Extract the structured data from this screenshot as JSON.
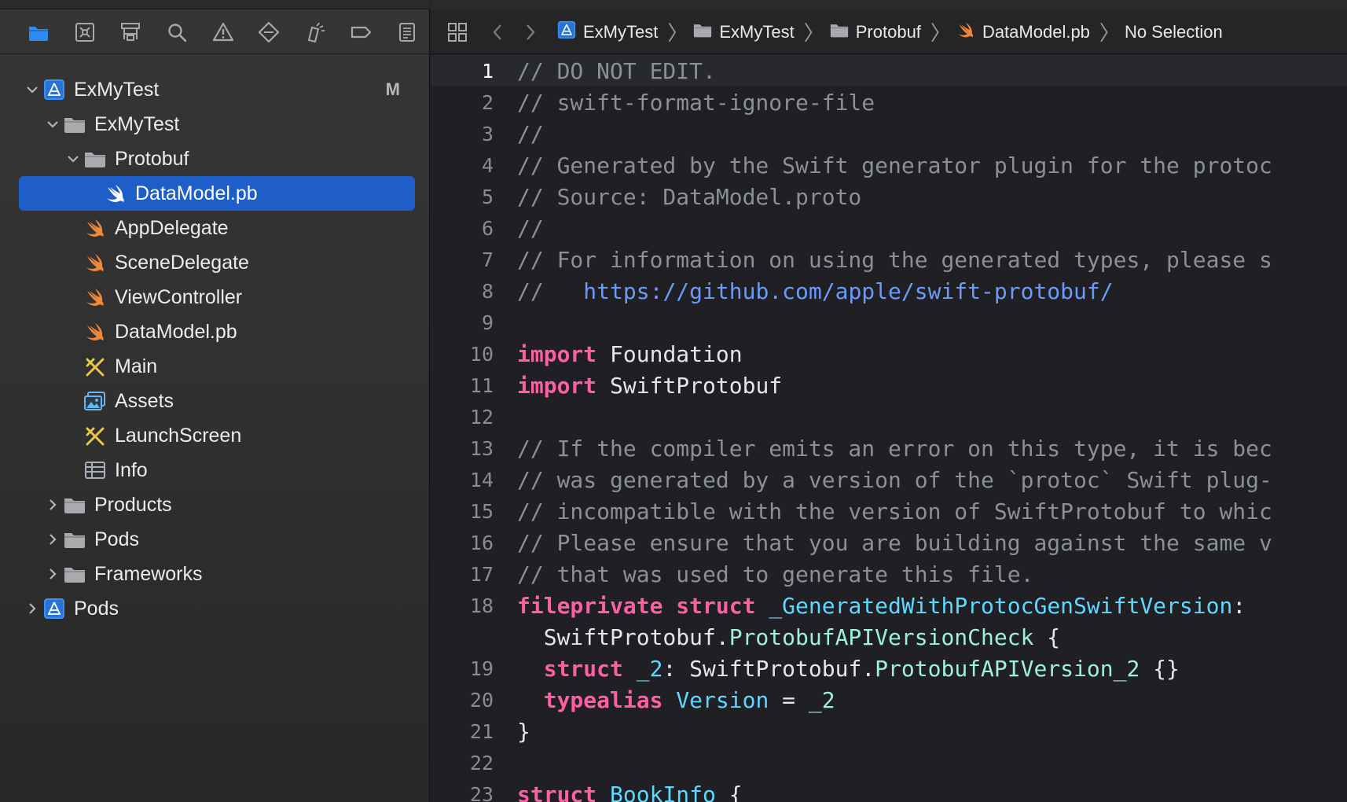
{
  "navigator": {
    "toolbar_icons": [
      "folder-icon",
      "source-control-icon",
      "symbol-icon",
      "search-icon",
      "warning-icon",
      "test-icon",
      "debug-icon",
      "breakpoint-icon",
      "report-icon"
    ],
    "tree": [
      {
        "label": "ExMyTest",
        "indent": 0,
        "chevron": "down",
        "icon": "project-icon",
        "badge": "M"
      },
      {
        "label": "ExMyTest",
        "indent": 1,
        "chevron": "down",
        "icon": "folder-icon"
      },
      {
        "label": "Protobuf",
        "indent": 2,
        "chevron": "down",
        "icon": "folder-icon"
      },
      {
        "label": "DataModel.pb",
        "indent": 3,
        "chevron": "none",
        "icon": "swift-file-icon",
        "selected": true
      },
      {
        "label": "AppDelegate",
        "indent": 2,
        "chevron": "none",
        "icon": "swift-file-icon"
      },
      {
        "label": "SceneDelegate",
        "indent": 2,
        "chevron": "none",
        "icon": "swift-file-icon"
      },
      {
        "label": "ViewController",
        "indent": 2,
        "chevron": "none",
        "icon": "swift-file-icon"
      },
      {
        "label": "DataModel.pb",
        "indent": 2,
        "chevron": "none",
        "icon": "swift-file-icon"
      },
      {
        "label": "Main",
        "indent": 2,
        "chevron": "none",
        "icon": "storyboard-icon"
      },
      {
        "label": "Assets",
        "indent": 2,
        "chevron": "none",
        "icon": "assets-icon"
      },
      {
        "label": "LaunchScreen",
        "indent": 2,
        "chevron": "none",
        "icon": "storyboard-icon"
      },
      {
        "label": "Info",
        "indent": 2,
        "chevron": "none",
        "icon": "plist-icon"
      },
      {
        "label": "Products",
        "indent": 1,
        "chevron": "right",
        "icon": "folder-icon"
      },
      {
        "label": "Pods",
        "indent": 1,
        "chevron": "right",
        "icon": "folder-icon"
      },
      {
        "label": "Frameworks",
        "indent": 1,
        "chevron": "right",
        "icon": "folder-icon"
      },
      {
        "label": "Pods",
        "indent": 0,
        "chevron": "right",
        "icon": "project-icon"
      }
    ]
  },
  "jumpbar": {
    "crumbs": [
      {
        "label": "ExMyTest",
        "icon": "project-icon"
      },
      {
        "label": "ExMyTest",
        "icon": "folder-icon"
      },
      {
        "label": "Protobuf",
        "icon": "folder-icon"
      },
      {
        "label": "DataModel.pb",
        "icon": "swift-file-icon"
      },
      {
        "label": "No Selection",
        "icon": ""
      }
    ]
  },
  "editor": {
    "current_line": 1,
    "lines": [
      {
        "n": "1",
        "tokens": [
          [
            "cmt",
            "// DO NOT EDIT."
          ]
        ]
      },
      {
        "n": "2",
        "tokens": [
          [
            "cmt",
            "// swift-format-ignore-file"
          ]
        ]
      },
      {
        "n": "3",
        "tokens": [
          [
            "cmt",
            "//"
          ]
        ]
      },
      {
        "n": "4",
        "tokens": [
          [
            "cmt",
            "// Generated by the Swift generator plugin for the protoc"
          ]
        ]
      },
      {
        "n": "5",
        "tokens": [
          [
            "cmt",
            "// Source: DataModel.proto"
          ]
        ]
      },
      {
        "n": "6",
        "tokens": [
          [
            "cmt",
            "//"
          ]
        ]
      },
      {
        "n": "7",
        "tokens": [
          [
            "cmt",
            "// For information on using the generated types, please s"
          ]
        ]
      },
      {
        "n": "8",
        "tokens": [
          [
            "cmt",
            "//   "
          ],
          [
            "url",
            "https://github.com/apple/swift-protobuf/"
          ]
        ]
      },
      {
        "n": "9",
        "tokens": []
      },
      {
        "n": "10",
        "tokens": [
          [
            "kw",
            "import"
          ],
          [
            "plain",
            " Foundation"
          ]
        ]
      },
      {
        "n": "11",
        "tokens": [
          [
            "kw",
            "import"
          ],
          [
            "plain",
            " SwiftProtobuf"
          ]
        ]
      },
      {
        "n": "12",
        "tokens": []
      },
      {
        "n": "13",
        "tokens": [
          [
            "cmt",
            "// If the compiler emits an error on this type, it is bec"
          ]
        ]
      },
      {
        "n": "14",
        "tokens": [
          [
            "cmt",
            "// was generated by a version of the `protoc` Swift plug-"
          ]
        ]
      },
      {
        "n": "15",
        "tokens": [
          [
            "cmt",
            "// incompatible with the version of SwiftProtobuf to whic"
          ]
        ]
      },
      {
        "n": "16",
        "tokens": [
          [
            "cmt",
            "// Please ensure that you are building against the same v"
          ]
        ]
      },
      {
        "n": "17",
        "tokens": [
          [
            "cmt",
            "// that was used to generate this file."
          ]
        ]
      },
      {
        "n": "18",
        "tokens": [
          [
            "kw",
            "fileprivate"
          ],
          [
            "plain",
            " "
          ],
          [
            "kw",
            "struct"
          ],
          [
            "plain",
            " "
          ],
          [
            "type",
            "_GeneratedWithProtocGenSwiftVersion"
          ],
          [
            "plain",
            ":"
          ]
        ]
      },
      {
        "n": "",
        "tokens": [
          [
            "plain",
            "  SwiftProtobuf."
          ],
          [
            "member",
            "ProtobufAPIVersionCheck"
          ],
          [
            "plain",
            " {"
          ]
        ]
      },
      {
        "n": "19",
        "tokens": [
          [
            "plain",
            "  "
          ],
          [
            "kw",
            "struct"
          ],
          [
            "plain",
            " "
          ],
          [
            "type",
            "_2"
          ],
          [
            "plain",
            ": SwiftProtobuf."
          ],
          [
            "member",
            "ProtobufAPIVersion_2"
          ],
          [
            "plain",
            " {}"
          ]
        ]
      },
      {
        "n": "20",
        "tokens": [
          [
            "plain",
            "  "
          ],
          [
            "kw",
            "typealias"
          ],
          [
            "plain",
            " "
          ],
          [
            "type",
            "Version"
          ],
          [
            "plain",
            " = "
          ],
          [
            "member",
            "_2"
          ]
        ]
      },
      {
        "n": "21",
        "tokens": [
          [
            "plain",
            "}"
          ]
        ]
      },
      {
        "n": "22",
        "tokens": []
      },
      {
        "n": "23",
        "tokens": [
          [
            "kw",
            "struct"
          ],
          [
            "plain",
            " "
          ],
          [
            "type",
            "BookInfo"
          ],
          [
            "plain",
            " {"
          ]
        ]
      }
    ]
  },
  "colors": {
    "selection": "#1f5dc8",
    "keyword": "#fc5fa3",
    "comment": "#8a9097",
    "url": "#6b9bfa",
    "type_decl": "#5dd8ff",
    "member": "#9ef0d8",
    "swift_orange": "#f0883a",
    "folder_blue": "#2f8cf0"
  }
}
